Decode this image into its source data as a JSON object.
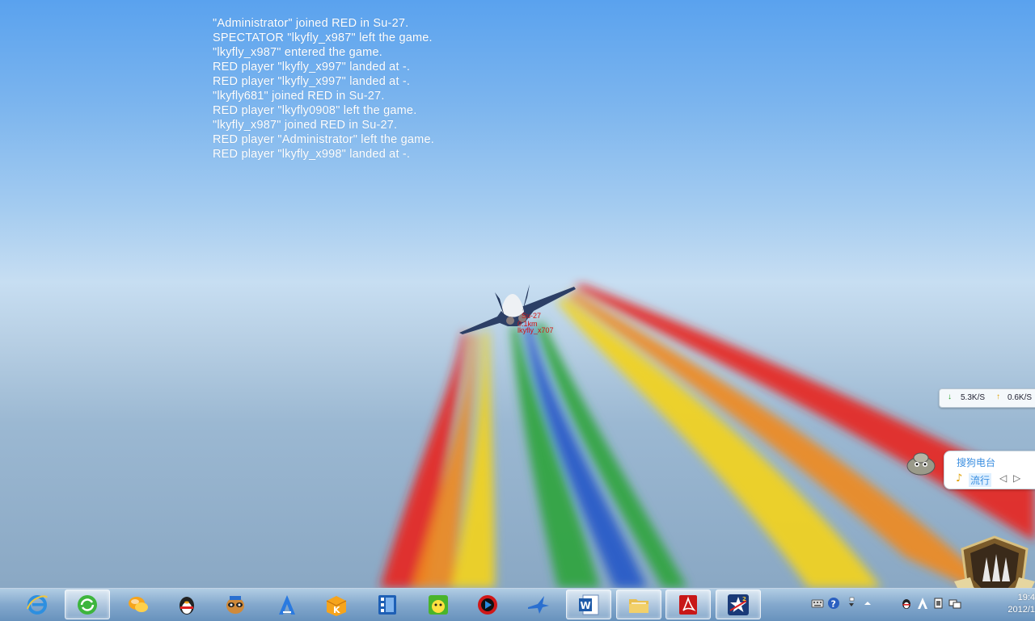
{
  "chat_log": [
    "\"Administrator\" joined RED in Su-27.",
    "SPECTATOR \"lkyfly_x987\" left the game.",
    "\"lkyfly_x987\" entered the game.",
    "RED player \"lkyfly_x997\" landed at -.",
    "RED player \"lkyfly_x997\" landed at -.",
    "\"lkyfly681\" joined RED in Su-27.",
    "RED player \"lkyfly0908\" left the game.",
    "\"lkyfly_x987\" joined RED in Su-27.",
    "RED player \"Administrator\" left the game.",
    "RED player \"lkyfly_x998\" landed at -."
  ],
  "target": {
    "aircraft": "Su-27",
    "distance": "0.1km",
    "player": "lkyfly_x707"
  },
  "speed_widget": {
    "download": "5.3K/S",
    "upload": "0.6K/S"
  },
  "radio": {
    "title": "搜狗电台",
    "genre": "流行"
  },
  "clock": {
    "time": "19:4",
    "date": "2012/1"
  },
  "smoke_colors": [
    "#e8221c",
    "#f08a1c",
    "#f2d21c",
    "#2ea43a",
    "#2656c8"
  ],
  "taskbar_apps": [
    "internet-explorer-icon",
    "sync-browser-icon",
    "chat-bubbles-icon",
    "qq-penguin-icon",
    "raccoon-assistant-icon",
    "a-letter-app-icon",
    "k-box-icon",
    "video-library-icon",
    "pps-player-icon",
    "media-player-icon",
    "jet-fighter-icon",
    "word-icon",
    "folder-icon",
    "pdf-reader-icon",
    "star-game-icon"
  ]
}
